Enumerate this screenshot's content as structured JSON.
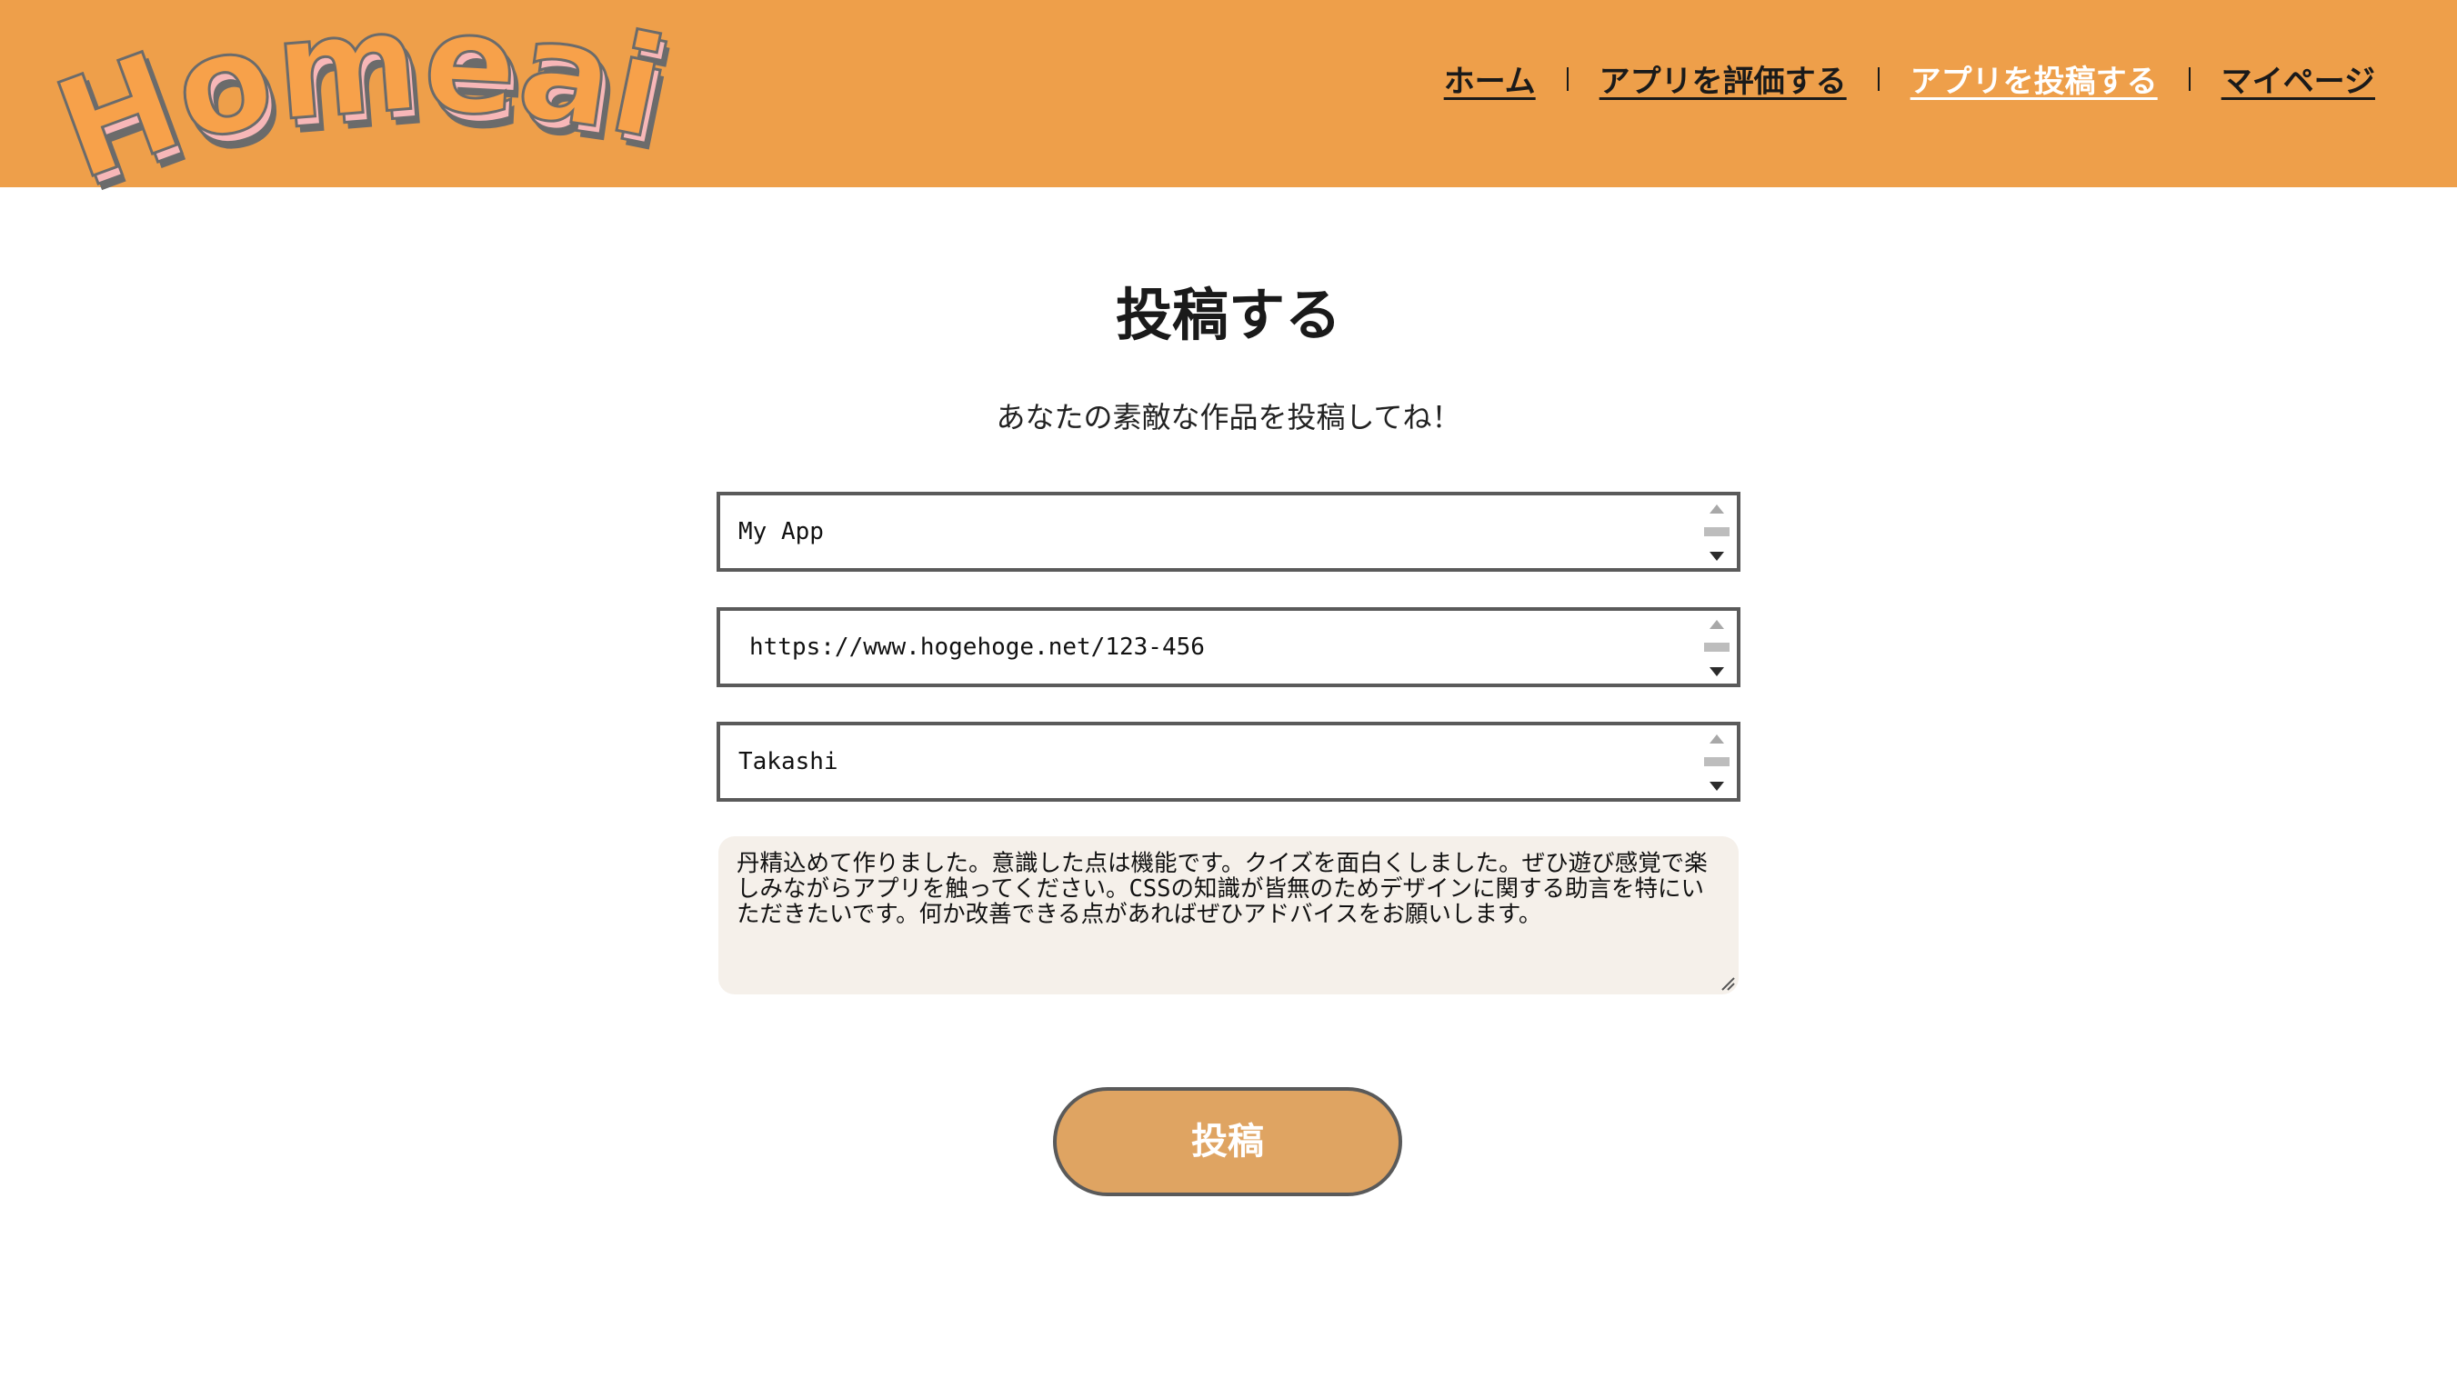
{
  "header": {
    "logo_text": "Homeai",
    "nav": [
      {
        "label": "ホーム",
        "active": false
      },
      {
        "label": "アプリを評価する",
        "active": false
      },
      {
        "label": "アプリを投稿する",
        "active": true
      },
      {
        "label": "マイページ",
        "active": false
      }
    ]
  },
  "main": {
    "title": "投稿する",
    "subtitle": "あなたの素敵な作品を投稿してね！",
    "fields": {
      "app_name": "My App",
      "app_url": "https://www.hogehoge.net/123-456",
      "author": "Takashi"
    },
    "comment": "丹精込めて作りました。意識した点は機能です。クイズを面白くしました。ぜひ遊び感覚で楽しみながらアプリを触ってください。CSSの知識が皆無のためデザインに関する助言を特にいただきたいです。何か改善できる点があればぜひアドバイスをお願いします。",
    "submit_label": "投稿"
  },
  "colors": {
    "header_bg": "#ee9f4a",
    "logo_fill": "#f7a14a",
    "logo_shadow_pink": "#f7b7b8",
    "logo_shadow_gray": "#6b6b6b",
    "textarea_bg": "#f5f0ea",
    "button_bg": "#dfa462"
  }
}
